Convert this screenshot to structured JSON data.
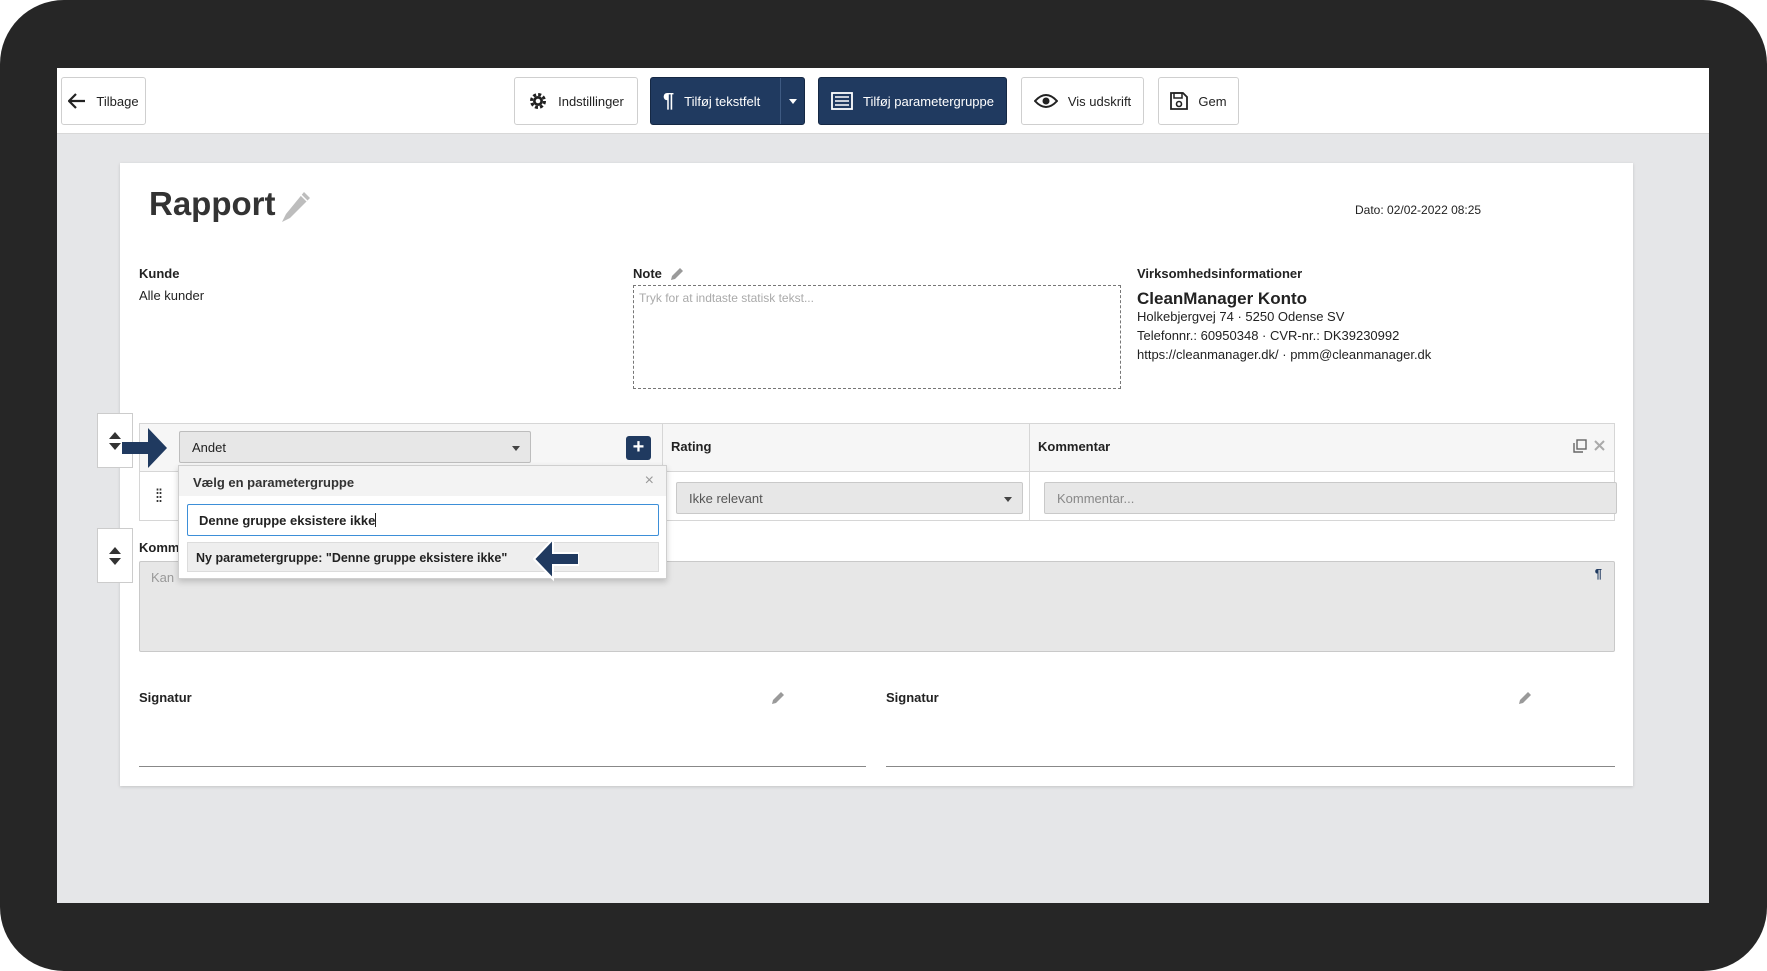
{
  "toolbar": {
    "back_label": "Tilbage",
    "settings_label": "Indstillinger",
    "add_textfield_label": "Tilføj tekstfelt",
    "add_paramgroup_label": "Tilføj parametergruppe",
    "preview_label": "Vis udskrift",
    "save_label": "Gem"
  },
  "report": {
    "title": "Rapport",
    "date": "Dato: 02/02-2022 08:25",
    "kunde_label": "Kunde",
    "kunde_value": "Alle kunder",
    "note_label": "Note",
    "note_placeholder": "Tryk for at indtaste statisk tekst...",
    "company_label": "Virksomhedsinformationer",
    "company_name": "CleanManager Konto",
    "company_address": "Holkebjergvej 74 · 5250 Odense SV",
    "company_phone": "Telefonnr.: 60950348 · CVR-nr.: DK39230992",
    "company_web": "https://cleanmanager.dk/ · pmm@cleanmanager.dk"
  },
  "table": {
    "group_value": "Andet",
    "col_rating": "Rating",
    "col_comment": "Kommentar",
    "rating_value": "Ikke relevant",
    "comment_placeholder": "Kommentar..."
  },
  "comment_section": {
    "label": "Komm",
    "placeholder": "Kan"
  },
  "signatures": {
    "left_label": "Signatur",
    "right_label": "Signatur"
  },
  "dropdown": {
    "title": "Vælg en parametergruppe",
    "search_value": "Denne gruppe eksistere ikke",
    "option_label": "Ny parametergruppe: \"Denne gruppe eksistere ikke\""
  },
  "colors": {
    "primary": "#203a60",
    "frame": "#262626",
    "canvas": "#e5e6e8",
    "arrow": "#203a60"
  }
}
